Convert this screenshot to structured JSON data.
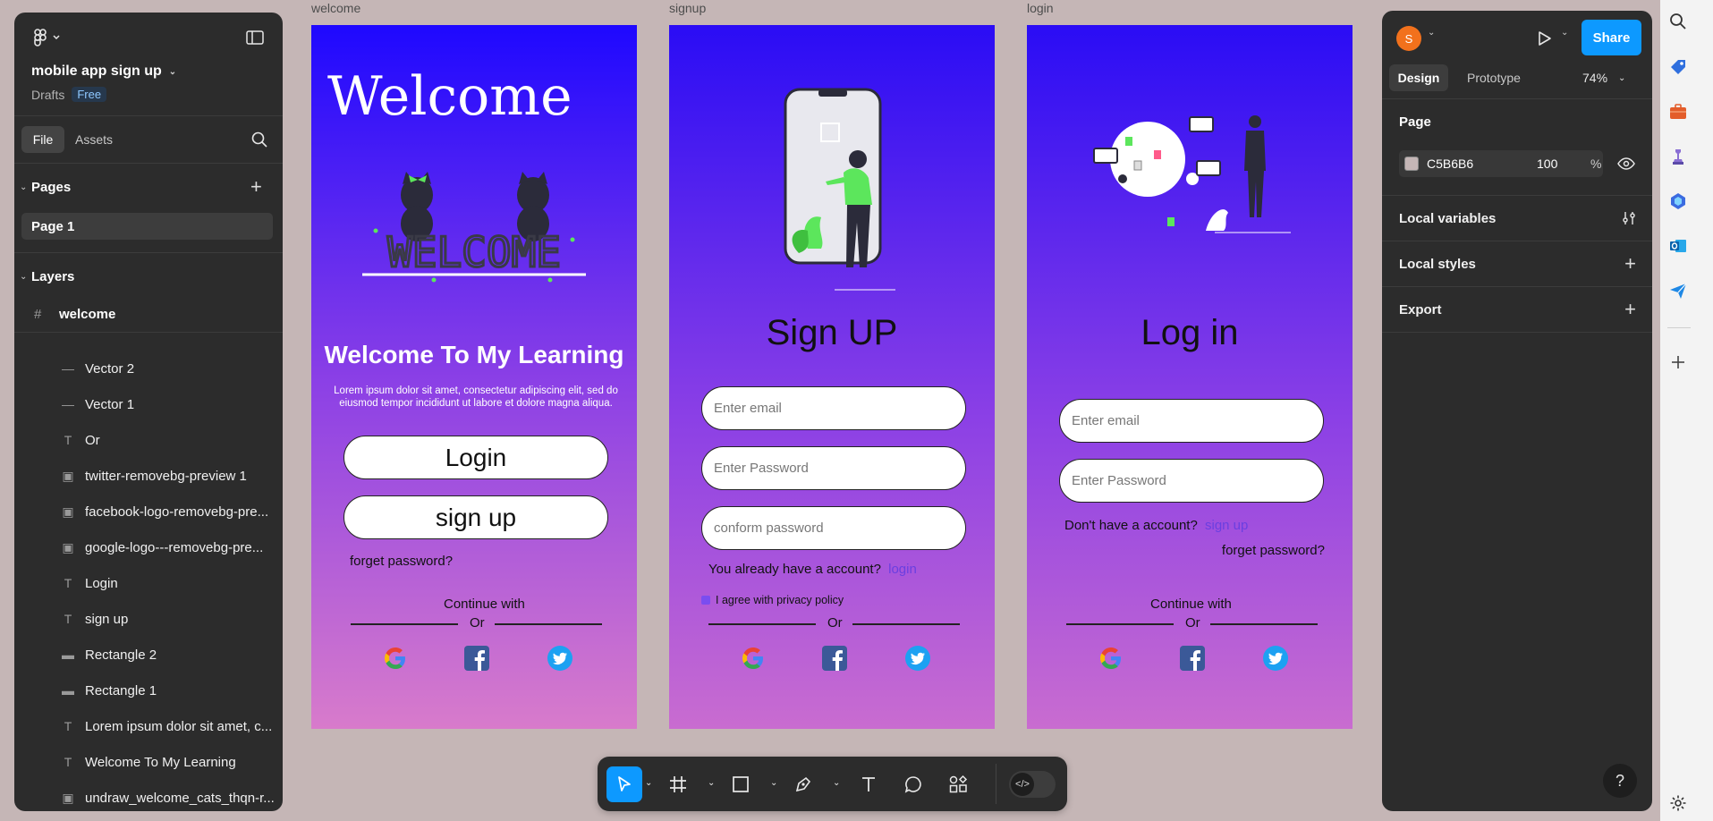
{
  "left_panel": {
    "file_name": "mobile app sign up",
    "drafts": "Drafts",
    "plan_badge": "Free",
    "tab_file": "File",
    "tab_assets": "Assets",
    "pages_title": "Pages",
    "page_item": "Page 1",
    "layers_title": "Layers",
    "layers_root": "welcome",
    "layers": [
      {
        "type": "vector",
        "name": "Vector 2"
      },
      {
        "type": "vector",
        "name": "Vector 1"
      },
      {
        "type": "text",
        "name": "Or"
      },
      {
        "type": "image",
        "name": "twitter-removebg-preview 1"
      },
      {
        "type": "image",
        "name": "facebook-logo-removebg-pre..."
      },
      {
        "type": "image",
        "name": "google-logo---removebg-pre..."
      },
      {
        "type": "text",
        "name": "Login"
      },
      {
        "type": "text",
        "name": "sign up"
      },
      {
        "type": "rect",
        "name": "Rectangle 2"
      },
      {
        "type": "rect",
        "name": "Rectangle 1"
      },
      {
        "type": "text",
        "name": "Lorem ipsum dolor sit amet, c..."
      },
      {
        "type": "text",
        "name": "Welcome To My Learning"
      },
      {
        "type": "image",
        "name": "undraw_welcome_cats_thqn-r..."
      }
    ]
  },
  "canvas": {
    "background": "#C5B6B6",
    "welcome": {
      "label": "welcome",
      "heading": "Welcome",
      "art_text": "WELCOME",
      "title": "Welcome To My Learning",
      "body": "Lorem ipsum dolor sit amet, consectetur adipiscing elit, sed do eiusmod tempor incididunt ut labore et dolore magna aliqua.",
      "login_btn": "Login",
      "signup_btn": "sign up",
      "forgot": "forget password?",
      "continue": "Continue with",
      "or": "Or"
    },
    "signup": {
      "label": "signup",
      "title": "Sign UP",
      "email_ph": "Enter email",
      "password_ph": "Enter Password",
      "confirm_ph": "conform password",
      "have_account": "You already have a account?",
      "login_link": "login",
      "agree": "I agree with privacy policy",
      "or": "Or"
    },
    "login": {
      "label": "login",
      "title": "Log in",
      "email_ph": "Enter email",
      "password_ph": "Enter Password",
      "no_account": "Don't have a account?",
      "signup_link": "sign up",
      "forgot": "forget password?",
      "continue": "Continue with",
      "or": "Or"
    }
  },
  "right_panel": {
    "avatar_initial": "S",
    "share": "Share",
    "tab_design": "Design",
    "tab_prototype": "Prototype",
    "zoom": "74%",
    "page_title": "Page",
    "page_color": "C5B6B6",
    "page_opacity": "100",
    "percent": "%",
    "local_variables": "Local variables",
    "local_styles": "Local styles",
    "export": "Export"
  },
  "colors": {
    "accent": "#0D99FF",
    "panel": "#2C2C2C",
    "frame_top": "#1E08FF",
    "frame_bottom": "#D87BCB",
    "green": "#5CE65C"
  },
  "help": "?"
}
